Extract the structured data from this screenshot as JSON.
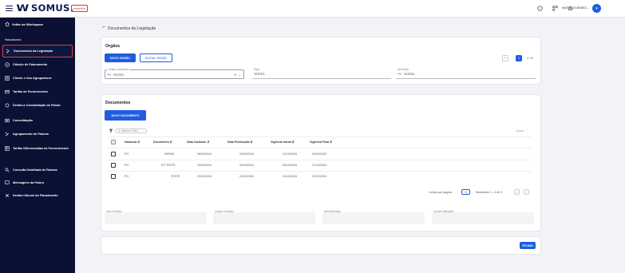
{
  "header": {
    "logo": "SOMUS.",
    "version_badge": "versionBox",
    "user_name": "MATHEUS MENEZ...",
    "user_initial": "▾"
  },
  "sidebar": {
    "back_label": "Voltar ao Workspace",
    "section_label": "Faturamento",
    "items": [
      {
        "label": "Documentos da Legislação",
        "icon": "document-edit-icon",
        "active": true
      },
      {
        "label": "Cálculo de Faturamento",
        "icon": "calculator-icon"
      },
      {
        "label": "Cliente x Uso Agrupadores",
        "icon": "grid-icon"
      },
      {
        "label": "Tarifas de Fornecimento",
        "icon": "card-icon"
      },
      {
        "label": "Desfaz a Consolidação de Fatura",
        "icon": "undo-icon"
      },
      {
        "label": "Consolidação",
        "icon": "stack-icon"
      },
      {
        "label": "Agrupamento de Faturas",
        "icon": "group-icon"
      },
      {
        "label": "Tarifas Diferenciadas de Fornecimento",
        "icon": "table-icon"
      },
      {
        "label": "Consulta Detalhada de Faturas",
        "icon": "search-icon"
      },
      {
        "label": "Mensagens da Fatura",
        "icon": "message-icon"
      },
      {
        "label": "Desfaz Cálculo do Faturamento",
        "icon": "cancel-icon"
      }
    ]
  },
  "page": {
    "title": "Documentos da Legislação"
  },
  "orgaos": {
    "title": "Orgãos",
    "new_button": "NOVO ORGÃO",
    "edit_button": "EDITAR ORGÃO",
    "pager_current": "1",
    "pager_total": "1 / 8",
    "codigo_label": "Código Legislação",
    "codigo_value": "YY - TESTE1",
    "sigla_label": "Sigla",
    "sigla_value": "TESTE1",
    "descricao_label": "Descrição",
    "descricao_value": "YY - TESTE1"
  },
  "documentos": {
    "title": "Documentos",
    "new_button": "NOVO DOCUMENTO",
    "filter_chip": "Adicionar Filtro",
    "acoes": "Ações",
    "columns": [
      "Natureza",
      "Documento",
      "Data Cadastro",
      "Data Publicação",
      "Vigência Inicial",
      "Vigência Final"
    ],
    "rows": [
      [
        "PO",
        "999999",
        "26/09/2024",
        "26/09/2024",
        "01/10/2024",
        "30/12/2024"
      ],
      [
        "PO",
        "PO TESTE",
        "24/10/2024",
        "25/10/2024",
        "26/10/2024",
        "27/10/2024"
      ],
      [
        "PO",
        "TESTE",
        "23/10/2024",
        "24/10/2024",
        "31/10/2024",
        "31/10/2024"
      ]
    ],
    "rows_per_page_label": "Linhas por página:",
    "rows_per_page_value": "5",
    "showing": "Mostrando 1 - 3 de 3"
  },
  "audit": {
    "data_inclusao": "Data Inclusão",
    "usuario_inclusao": "Usuário Inclusão",
    "data_alteracao": "Data Alteração",
    "usuario_alteracao": "Usuário Alteração",
    "empty": "-"
  },
  "footer": {
    "fechar": "FECHAR"
  }
}
